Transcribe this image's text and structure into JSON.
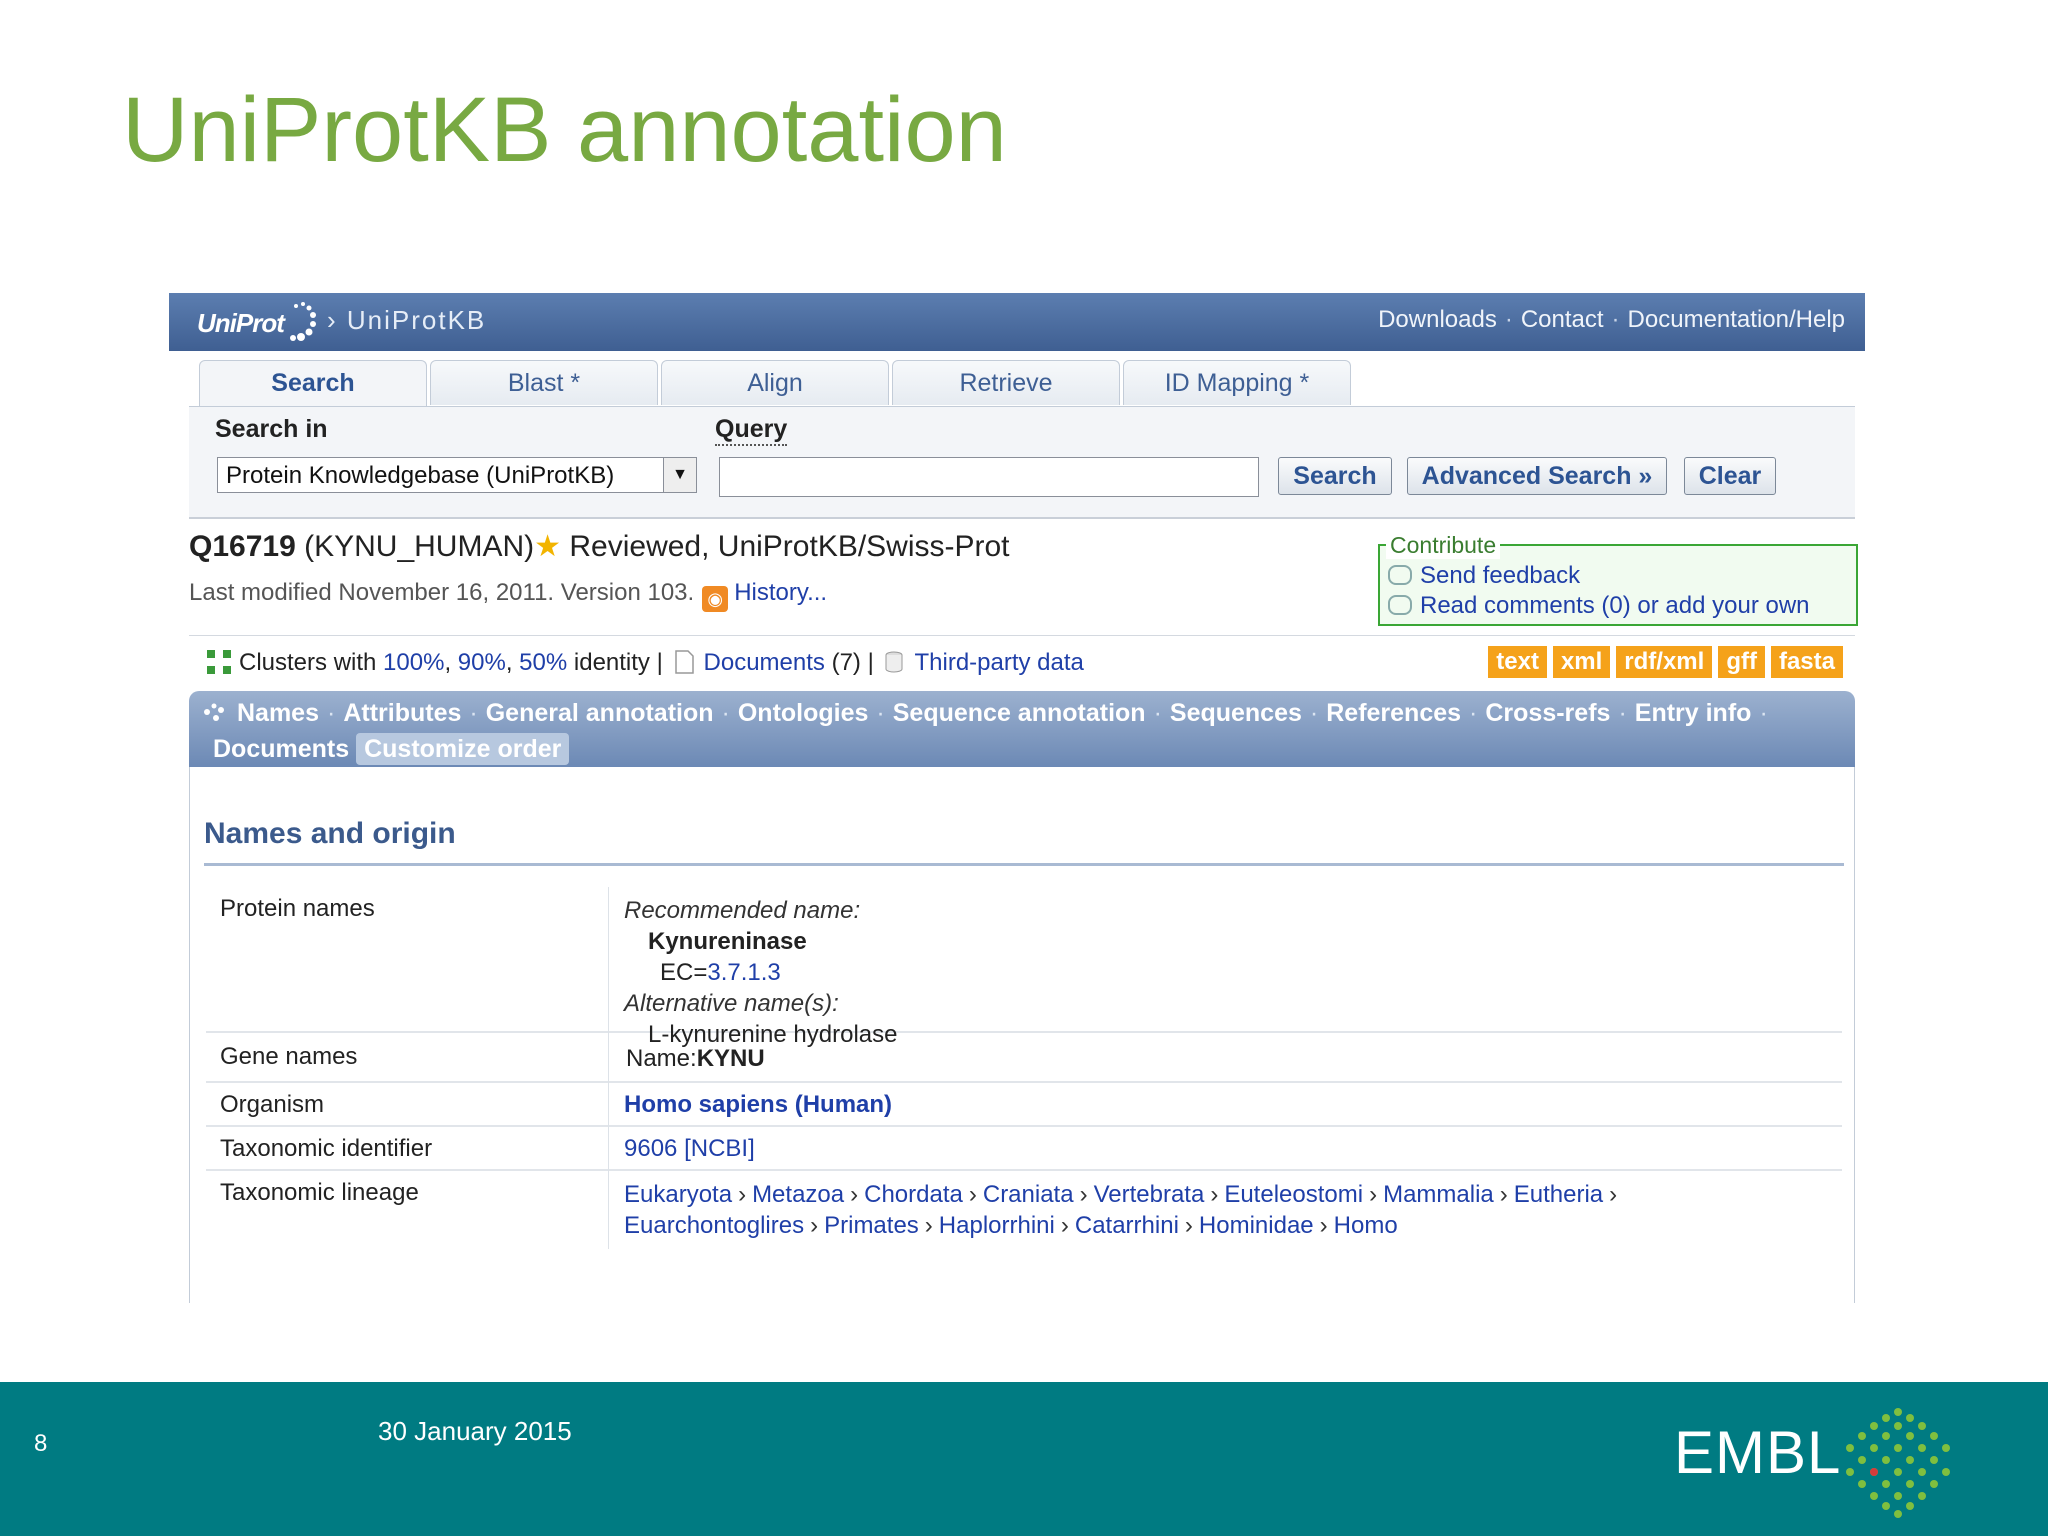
{
  "slide": {
    "title": "UniProtKB annotation",
    "page_number": "8",
    "date": "30 January 2015",
    "footer_logo": "EMBL"
  },
  "header": {
    "logo": "UniProt",
    "crumb": "› UniProtKB",
    "links": [
      "Downloads",
      "Contact",
      "Documentation/Help"
    ]
  },
  "tabs": [
    "Search",
    "Blast *",
    "Align",
    "Retrieve",
    "ID Mapping *"
  ],
  "search": {
    "search_in_label": "Search in",
    "query_label": "Query",
    "database": "Protein Knowledgebase (UniProtKB)",
    "query_value": "",
    "search_btn": "Search",
    "advanced_btn": "Advanced Search »",
    "clear_btn": "Clear"
  },
  "entry": {
    "accession": "Q16719",
    "name": "(KYNU_HUMAN)",
    "status": "Reviewed, UniProtKB/Swiss-Prot",
    "last_modified": "Last modified November 16, 2011. Version 103.",
    "history": "History..."
  },
  "contribute": {
    "legend": "Contribute",
    "feedback": "Send feedback",
    "comments": "Read comments (0) or add your own"
  },
  "clusters": {
    "prefix": "Clusters with",
    "p100": "100%",
    "p90": "90%",
    "p50": "50%",
    "identity": "identity |",
    "documents": "Documents",
    "documents_count": "(7) |",
    "third_party": "Third-party data",
    "formats": [
      "text",
      "xml",
      "rdf/xml",
      "gff",
      "fasta"
    ]
  },
  "nav": {
    "row1": [
      "Names",
      "Attributes",
      "General annotation",
      "Ontologies",
      "Sequence annotation",
      "Sequences",
      "References",
      "Cross-refs",
      "Entry info"
    ],
    "documents": "Documents",
    "customize": "Customize order"
  },
  "names_origin": {
    "title": "Names and origin",
    "protein_names_label": "Protein names",
    "recommended_label": "Recommended name:",
    "recommended_value": "Kynureninase",
    "ec_prefix": "EC=",
    "ec_value": "3.7.1.3",
    "alternative_label": "Alternative name(s):",
    "alternative_value": "L-kynurenine hydrolase",
    "gene_names_label": "Gene names",
    "gene_prefix": "Name:",
    "gene_value": "KYNU",
    "organism_label": "Organism",
    "organism_value": "Homo sapiens (Human)",
    "taxid_label": "Taxonomic identifier",
    "taxid_value": "9606",
    "taxid_source": "[NCBI]",
    "lineage_label": "Taxonomic lineage",
    "lineage_row1": [
      "Eukaryota",
      "Metazoa",
      "Chordata",
      "Craniata",
      "Vertebrata",
      "Euteleostomi",
      "Mammalia",
      "Eutheria"
    ],
    "lineage_row2": [
      "Euarchontoglires",
      "Primates",
      "Haplorrhini",
      "Catarrhini",
      "Hominidae",
      "Homo"
    ]
  },
  "colors": {
    "title_green": "#78a942",
    "header_blue": "#3f5f92",
    "link_blue": "#1f3fa8",
    "format_orange": "#f5a21a",
    "footer_teal": "#007b82"
  }
}
